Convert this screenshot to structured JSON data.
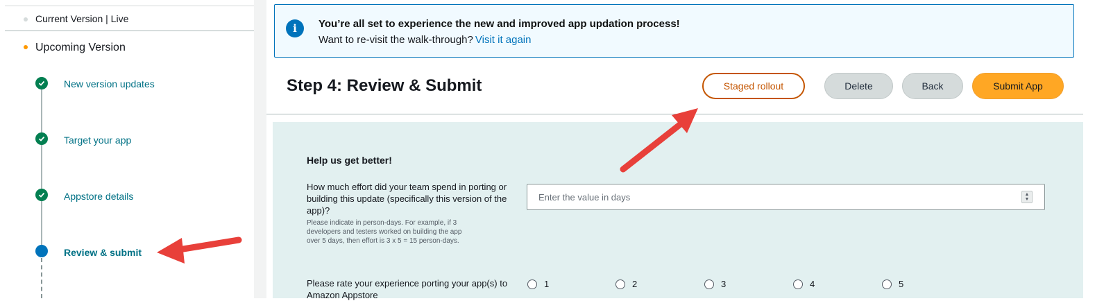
{
  "sidebar": {
    "current_version": "Current Version | Live",
    "upcoming_version": "Upcoming Version",
    "steps": [
      {
        "label": "New version updates",
        "state": "complete"
      },
      {
        "label": "Target your app",
        "state": "complete"
      },
      {
        "label": "Appstore details",
        "state": "complete"
      },
      {
        "label": "Review & submit",
        "state": "current"
      }
    ]
  },
  "banner": {
    "title": "You’re all set to experience the new and improved app updation process!",
    "text": "Want to re-visit the walk-through?",
    "link": "Visit it again",
    "icon": "info-icon"
  },
  "header": {
    "title": "Step 4: Review & Submit",
    "buttons": {
      "staged_rollout": "Staged rollout",
      "delete": "Delete",
      "back": "Back",
      "submit": "Submit App"
    }
  },
  "survey": {
    "heading": "Help us get better!",
    "effort_question": "How much effort did your team spend in porting or building this update (specifically this version of the app)?",
    "effort_help": "Please indicate in person-days. For example, if 3 developers and testers worked on building the app over 5 days, then effort is 3 x 5 = 15 person-days.",
    "effort_placeholder": "Enter the value in days",
    "rating_question": "Please rate your experience porting your app(s) to Amazon Appstore",
    "rating_options": [
      "1",
      "2",
      "3",
      "4",
      "5"
    ]
  },
  "colors": {
    "link": "#007185",
    "check": "#037f51",
    "current_step": "#0073bb",
    "submit": "#ffa724",
    "staged": "#c45500",
    "annotation_arrow": "#e8403a"
  }
}
